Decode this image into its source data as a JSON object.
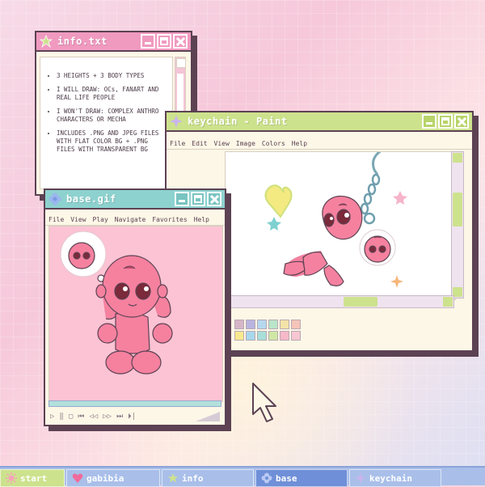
{
  "colors": {
    "pink": "#f09ac0",
    "green": "#cde28d",
    "teal": "#8dd2cf",
    "outline": "#5c4253",
    "cream": "#fdf7e7",
    "taskbar": "#a9bfe9"
  },
  "info_window": {
    "title": "info.txt",
    "icon": "star-icon",
    "bullets": [
      "3 HEIGHTS + 3 BODY TYPES",
      "I WILL DRAW: OCs, FANART AND REAL LIFE PEOPLE",
      "I WON'T DRAW: COMPLEX ANTHRO CHARACTERS OR MECHA",
      "INCLUDES .PNG AND JPEG FILES WITH FLAT COLOR BG + .PNG FILES WITH TRANSPARENT BG"
    ]
  },
  "paint_window": {
    "title": "keychain - Paint",
    "icon": "sparkle-icon",
    "menu": [
      "File",
      "Edit",
      "View",
      "Image",
      "Colors",
      "Help"
    ],
    "palette": [
      "#d6b6c6",
      "#b9b4e0",
      "#b6d8ef",
      "#b9e5c8",
      "#f3e3a7",
      "#f6c4b8",
      "#f7e98f",
      "#a8d8ec",
      "#a9dfd9",
      "#cfe7a5",
      "#f6b9c8",
      "#f7c7d2"
    ]
  },
  "base_window": {
    "title": "base.gif",
    "icon": "flower-icon",
    "menu": [
      "File",
      "View",
      "Play",
      "Navigate",
      "Favorites",
      "Help"
    ],
    "controls": [
      "▷",
      "‖",
      "▢",
      "⏮",
      "◁◁",
      "▷▷",
      "⏭",
      "⏵|"
    ]
  },
  "taskbar": {
    "items": [
      {
        "label": "start",
        "icon": "sun-icon",
        "bg": "#cde28d"
      },
      {
        "label": "gabibia",
        "icon": "heart-icon",
        "bg": "#a9bfe9"
      },
      {
        "label": "info",
        "icon": "star-icon",
        "bg": "#a9bfe9"
      },
      {
        "label": "base",
        "icon": "flower-icon",
        "bg": "#6f8fd8"
      },
      {
        "label": "keychain",
        "icon": "sparkle-icon",
        "bg": "#a9bfe9"
      }
    ]
  }
}
